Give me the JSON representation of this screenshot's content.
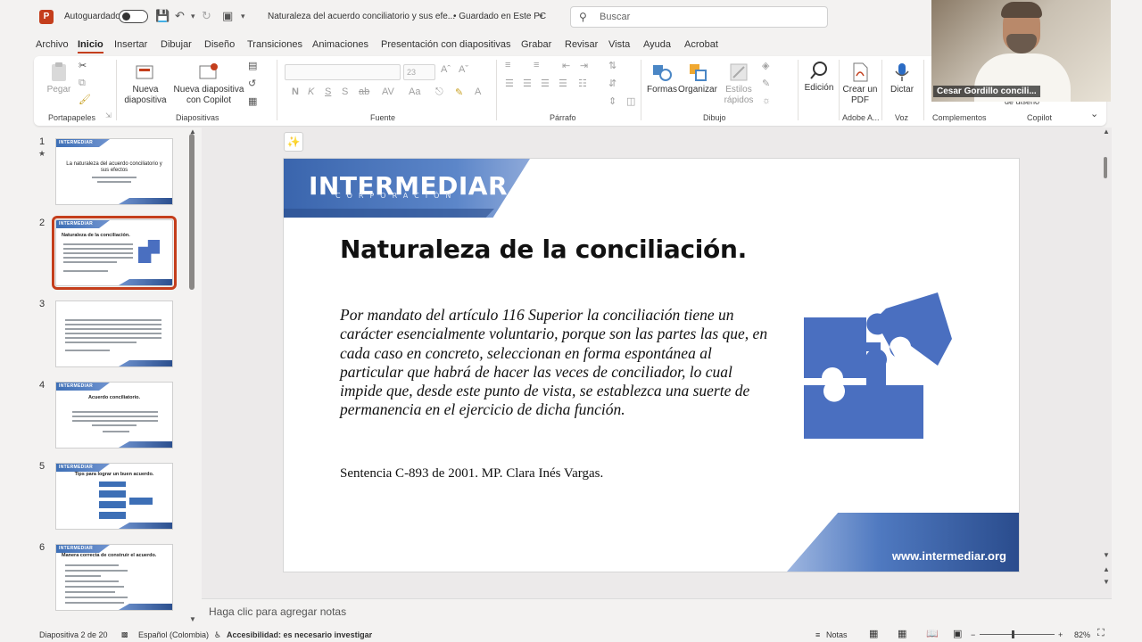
{
  "titlebar": {
    "app_icon": "P",
    "autosave_label": "Autoguardado",
    "doc_title": "Naturaleza del acuerdo conciliatorio y sus efe...",
    "saved_status": "• Guardado en Este PC",
    "search_placeholder": "Buscar"
  },
  "menu": {
    "tabs": [
      "Archivo",
      "Inicio",
      "Insertar",
      "Dibujar",
      "Diseño",
      "Transiciones",
      "Animaciones",
      "Presentación con diapositivas",
      "Grabar",
      "Revisar",
      "Vista",
      "Ayuda",
      "Acrobat"
    ],
    "active": "Inicio"
  },
  "ribbon": {
    "paste": "Pegar",
    "new_slide": "Nueva diapositiva",
    "new_slide_copilot": "Nueva diapositiva con Copilot",
    "font_size": "23",
    "font_buttons": [
      "N",
      "K",
      "S",
      "S",
      "ab",
      "AV",
      "Aa",
      "A"
    ],
    "shapes": "Formas",
    "arrange": "Organizar",
    "quick_styles": "Estilos rápidos",
    "editing": "Edición",
    "create_pdf": "Crear un PDF",
    "dictate": "Dictar",
    "design": "de diseño",
    "groups": {
      "clipboard": "Portapapeles",
      "slides": "Diapositivas",
      "font": "Fuente",
      "paragraph": "Párrafo",
      "drawing": "Dibujo",
      "adobe": "Adobe A...",
      "voice": "Voz",
      "addins": "Complementos",
      "copilot": "Copilot"
    }
  },
  "video": {
    "name": "Cesar Gordillo concili..."
  },
  "thumbnails": [
    {
      "num": "1",
      "star": "★",
      "title": "La naturaleza del acuerdo conciliatorio y sus efectos",
      "logo": "INTERMEDIAR"
    },
    {
      "num": "2",
      "title": "Naturaleza de la conciliación.",
      "logo": "INTERMEDIAR"
    },
    {
      "num": "3",
      "title": "",
      "logo": ""
    },
    {
      "num": "4",
      "title": "Acuerdo conciliatorio.",
      "logo": "INTERMEDIAR"
    },
    {
      "num": "5",
      "title": "Tips para lograr un buen acuerdo.",
      "logo": "INTERMEDIAR"
    },
    {
      "num": "6",
      "title": "Manera correcta de construir el acuerdo.",
      "logo": "INTERMEDIAR"
    }
  ],
  "slide": {
    "logo": "INTERMEDIAR",
    "logo_sub": "CORPORACIÓN",
    "title": "Naturaleza de la conciliación.",
    "quote": "Por mandato del artículo 116 Superior  la conciliación tiene un carácter esencialmente voluntario, porque son las partes las que, en cada caso en concreto, seleccionan en forma espontánea al particular que habrá de hacer las veces de conciliador, lo cual impide que, desde este punto de vista, se establezca una suerte de permanencia en el ejercicio de dicha función.",
    "citation": "Sentencia C-893 de 2001. MP. Clara Inés Vargas.",
    "url": "www.intermediar.org",
    "accent": "#3d6fb6"
  },
  "notes_placeholder": "Haga clic para agregar notas",
  "status": {
    "slide_pos": "Diapositiva 2 de 20",
    "language": "Español (Colombia)",
    "accessibility": "Accesibilidad: es necesario investigar",
    "notes": "Notas",
    "zoom": "82%"
  }
}
